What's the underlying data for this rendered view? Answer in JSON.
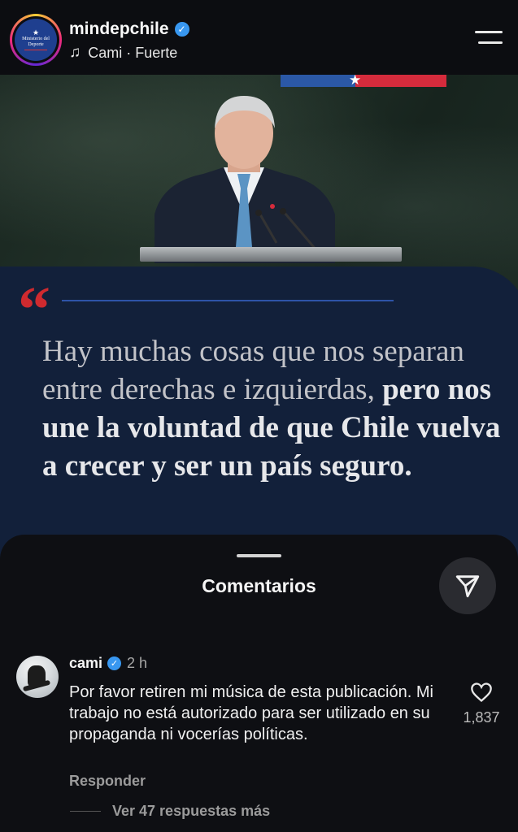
{
  "header": {
    "username": "mindepchile",
    "verified_glyph": "✓",
    "avatar_logo_text": "Ministerio del Deporte",
    "music_icon": "music-note-icon",
    "music_label": "Cami · Fuerte",
    "menu_icon": "hamburger-menu-icon"
  },
  "post": {
    "quote_mark": "“",
    "quote_regular": "Hay muchas cosas que nos separan entre derechas e izquierdas,",
    "quote_bold": "pero nos une la voluntad  de que Chile vuelva a crecer y ser un país seguro.",
    "colors": {
      "panel": "#12203a",
      "quote_mark": "#cf2a2f",
      "flag_blue": "#2b58a6",
      "flag_red": "#d52b3c"
    }
  },
  "comments_sheet": {
    "title": "Comentarios",
    "share_icon": "send-icon",
    "comment": {
      "username": "cami",
      "time": "2 h",
      "text": "Por favor retiren mi música de esta publicación. Mi trabajo no está autorizado para ser utilizado en su propaganda ni vocerías políticas.",
      "reply_label": "Responder",
      "like_icon": "heart-icon",
      "like_count": "1,837",
      "more_replies": "Ver 47 respuestas más"
    }
  }
}
